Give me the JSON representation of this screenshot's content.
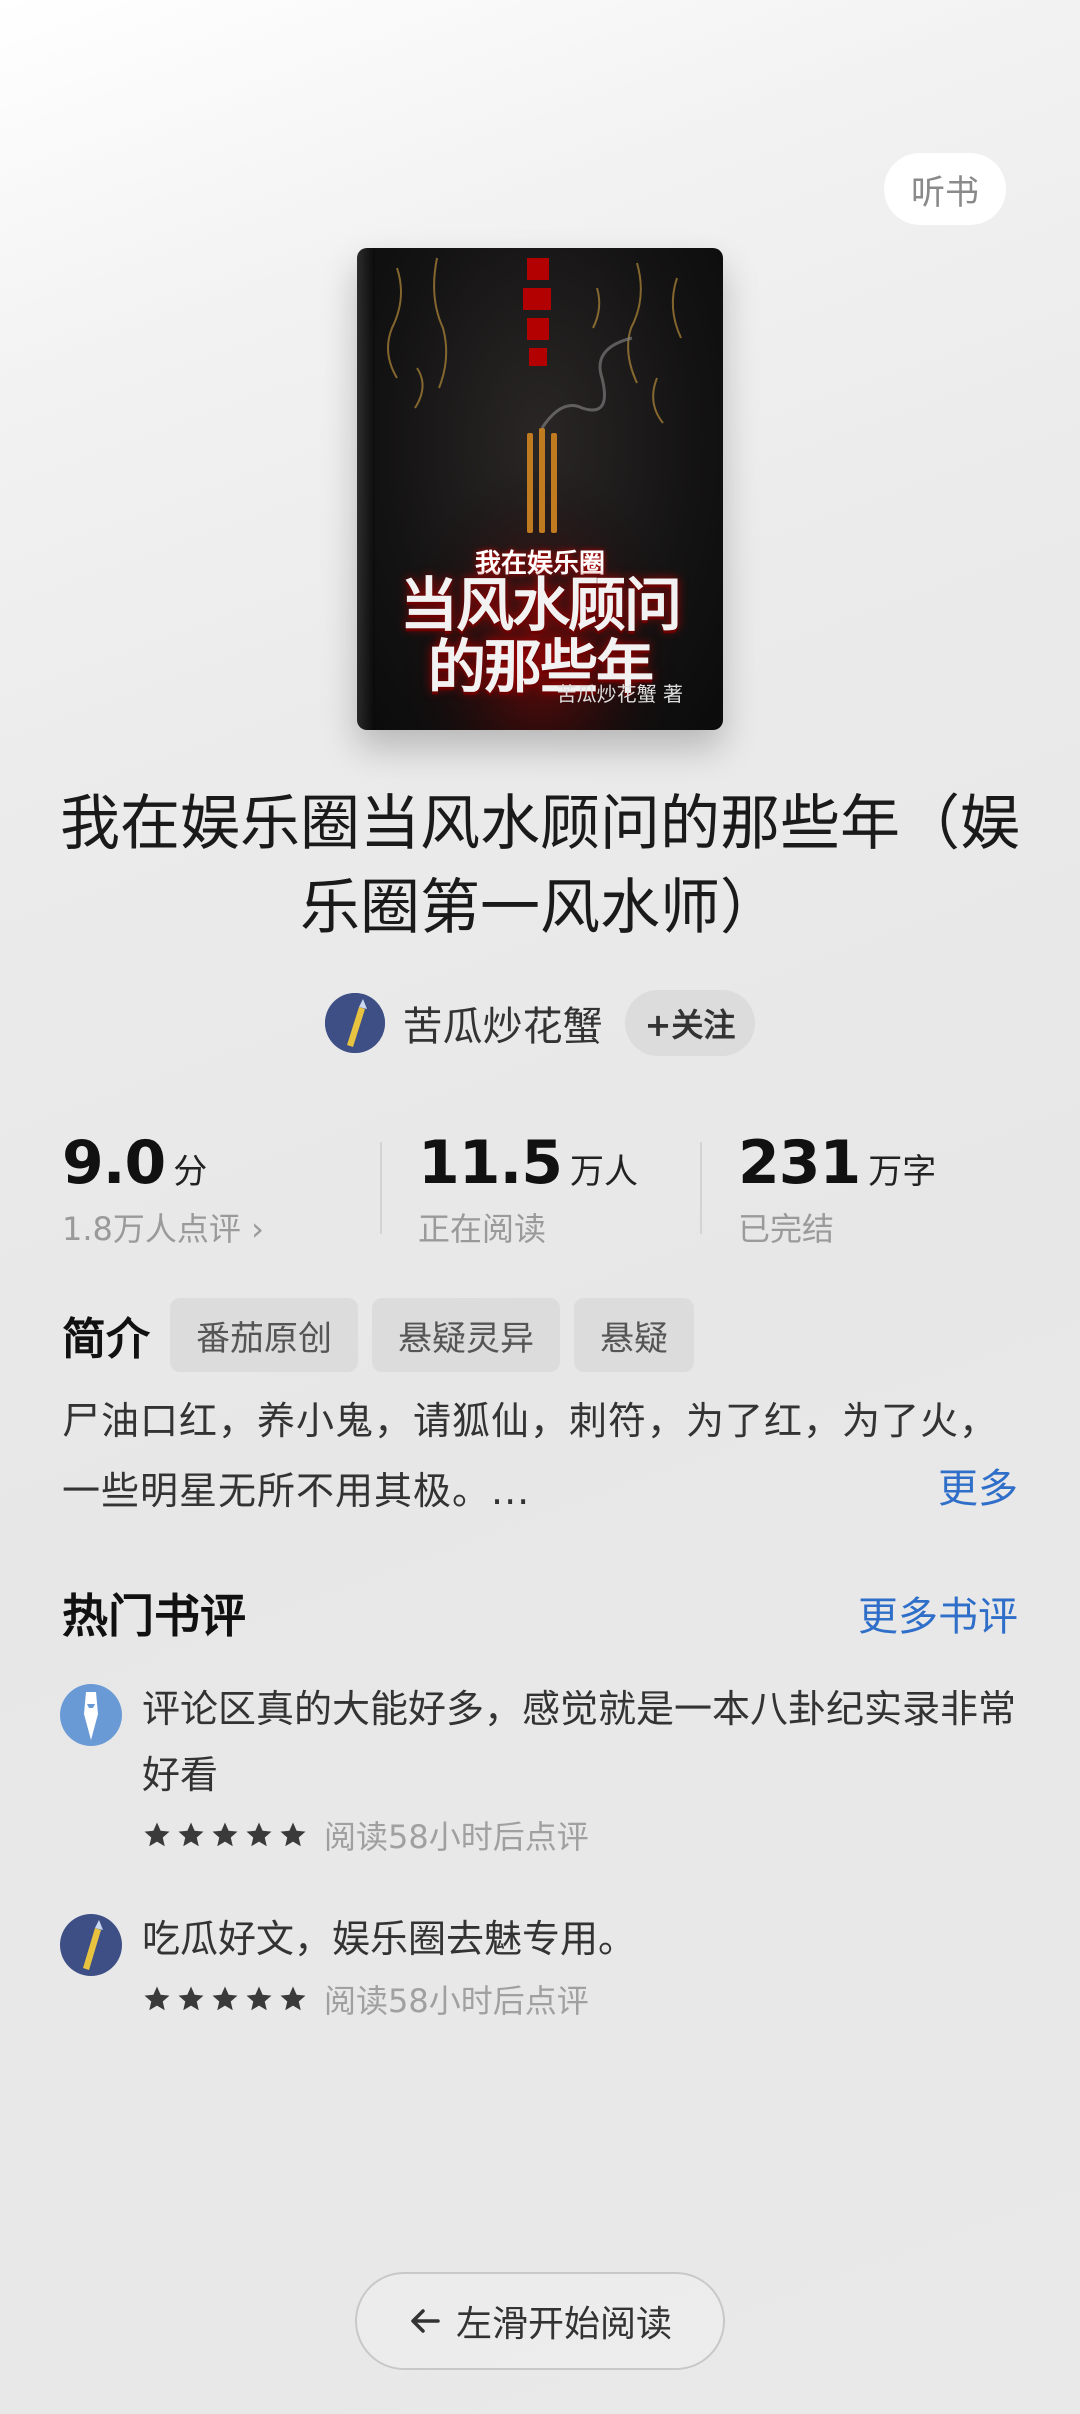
{
  "header": {
    "listen_label": "听书"
  },
  "cover": {
    "top_text": "我在娱乐圈",
    "title_line1": "当风水顾问",
    "title_line2": "的那些年",
    "author_text": "苦瓜炒花蟹 著"
  },
  "book": {
    "title": "我在娱乐圈当风水顾问的那些年（娱乐圈第一风水师）"
  },
  "author": {
    "name": "苦瓜炒花蟹",
    "follow_label": "+关注"
  },
  "stats": {
    "rating_value": "9.0",
    "rating_unit": "分",
    "rating_sub": "1.8万人点评 ›",
    "readers_value": "11.5",
    "readers_unit": "万人",
    "readers_sub": "正在阅读",
    "words_value": "231",
    "words_unit": "万字",
    "words_sub": "已完结"
  },
  "intro": {
    "label": "简介",
    "tags": [
      "番茄原创",
      "悬疑灵异",
      "悬疑"
    ],
    "synopsis": "尸油口红，养小鬼，请狐仙，刺符，为了红，为了火，一些明星无所不用其极。...",
    "more_label": "更多"
  },
  "reviews": {
    "title": "热门书评",
    "more_label": "更多书评",
    "items": [
      {
        "text": "评论区真的大能好多，感觉就是一本八卦纪实录非常好看",
        "stars": 5,
        "meta": "阅读58小时后点评"
      },
      {
        "text": "吃瓜好文，娱乐圈去魅专用。",
        "stars": 5,
        "meta": "阅读58小时后点评"
      }
    ]
  },
  "footer": {
    "start_label": "左滑开始阅读"
  },
  "colors": {
    "accent": "#2f6fc9",
    "muted": "#9a9a9a"
  }
}
